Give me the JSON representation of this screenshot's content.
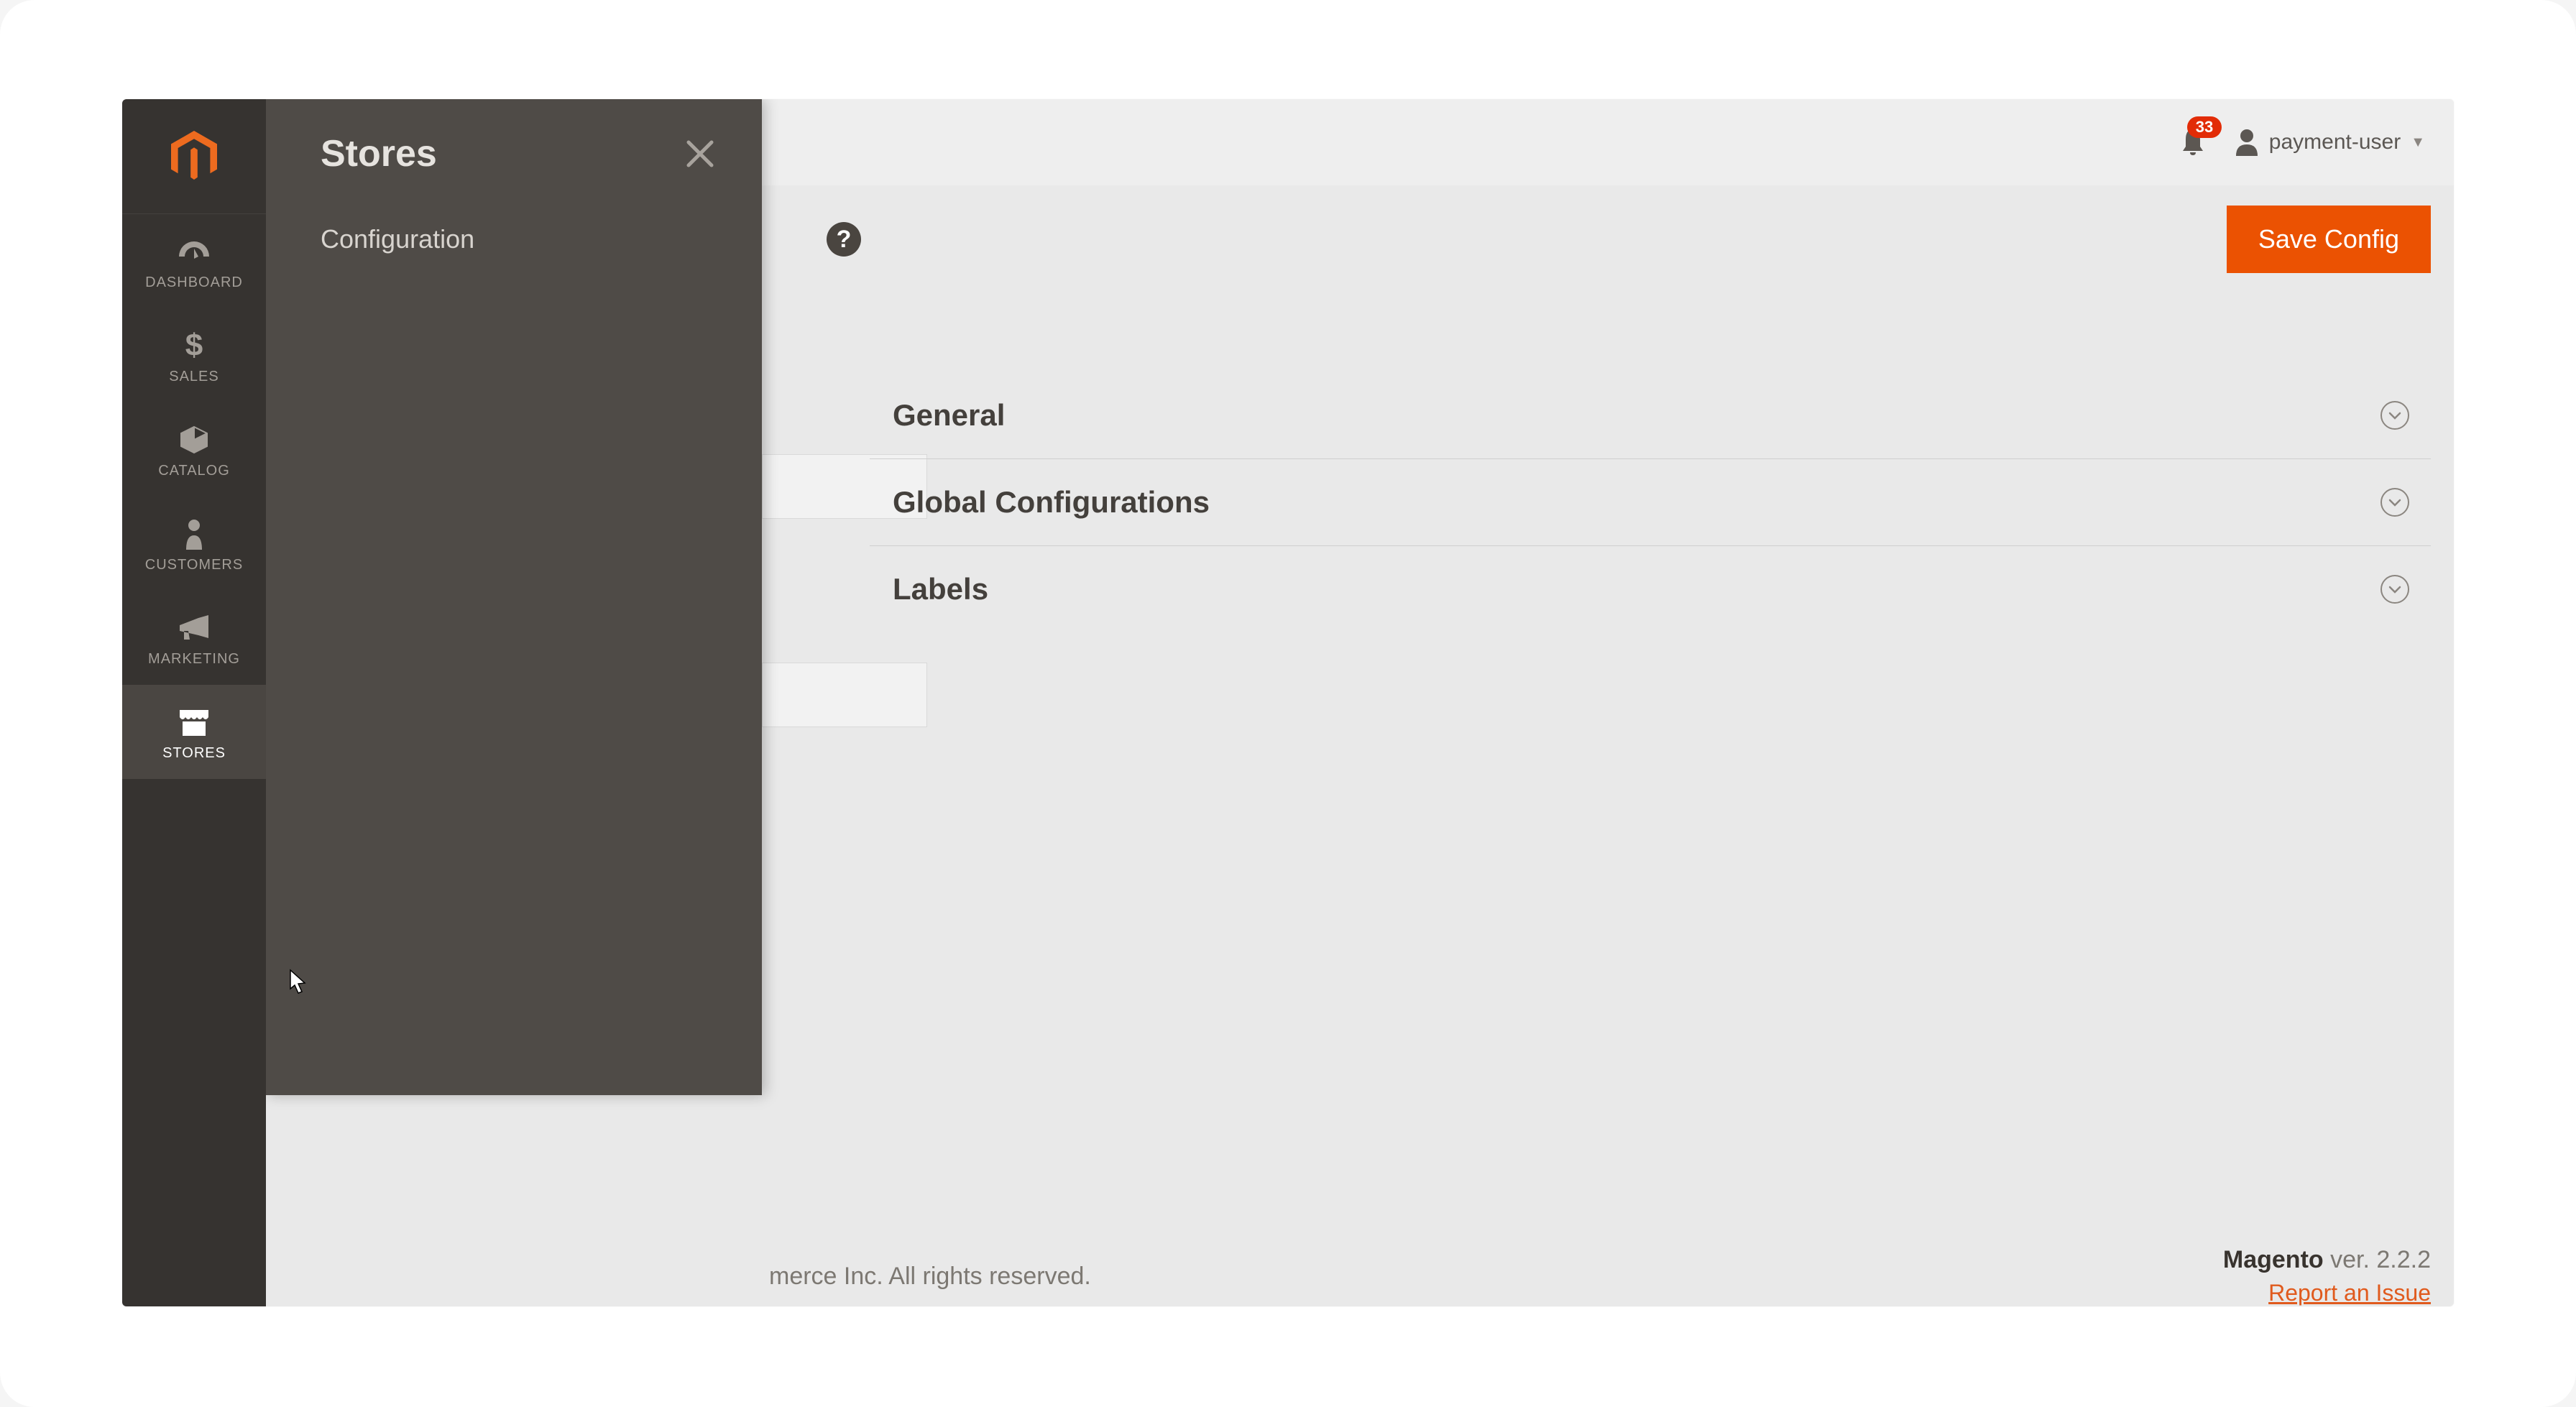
{
  "sidebar": {
    "items": [
      {
        "label": "DASHBOARD"
      },
      {
        "label": "SALES"
      },
      {
        "label": "CATALOG"
      },
      {
        "label": "CUSTOMERS"
      },
      {
        "label": "MARKETING"
      },
      {
        "label": "STORES"
      }
    ]
  },
  "flyout": {
    "title": "Stores",
    "items": [
      {
        "label": "Configuration"
      }
    ]
  },
  "header": {
    "notification_count": "33",
    "username": "payment-user"
  },
  "actions": {
    "save_label": "Save Config"
  },
  "config_sections": [
    {
      "label": "General"
    },
    {
      "label": "Global Configurations"
    },
    {
      "label": "Labels"
    }
  ],
  "footer": {
    "copyright_fragment": "merce Inc. All rights reserved.",
    "product_name": "Magento",
    "version": " ver. 2.2.2",
    "report_link": "Report an Issue"
  }
}
